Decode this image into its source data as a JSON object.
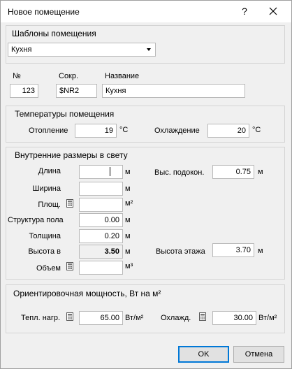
{
  "window": {
    "title": "Новое помещение",
    "help_label": "?"
  },
  "templates": {
    "title": "Шаблоны помещения",
    "selected": "Кухня"
  },
  "ident": {
    "number_label": "№",
    "number_value": "123",
    "short_label": "Сокр.",
    "short_value": "$NR2",
    "name_label": "Название",
    "name_value": "Кухня"
  },
  "temps": {
    "title": "Температуры помещения",
    "heating_label": "Отопление",
    "heating_value": "19",
    "heating_unit": "°C",
    "cooling_label": "Охлаждение",
    "cooling_value": "20",
    "cooling_unit": "°C"
  },
  "dims": {
    "title": "Внутренние размеры в свету",
    "length_label": "Длина",
    "length_value": "",
    "length_unit": "м",
    "width_label": "Ширина",
    "width_value": "",
    "width_unit": "м",
    "area_label": "Площ.",
    "area_value": "",
    "area_unit": "м²",
    "floor_label": "Структура пола",
    "floor_value": "0.00",
    "floor_unit": "м",
    "thickness_label": "Толщина",
    "thickness_value": "0.20",
    "thickness_unit": "м",
    "height_label": "Высота в",
    "height_value": "3.50",
    "height_unit": "м",
    "volume_label": "Объем",
    "volume_value": "",
    "volume_unit": "м³",
    "sill_label": "Выс. подокон.",
    "sill_value": "0.75",
    "sill_unit": "м",
    "floor_height_label": "Высота этажа",
    "floor_height_value": "3.70",
    "floor_height_unit": "м"
  },
  "power": {
    "title": "Ориентировочная мощность, Вт на м²",
    "heat_label": "Тепл. нагр.",
    "heat_value": "65.00",
    "heat_unit": "Вт/м²",
    "cool_label": "Охлажд.",
    "cool_value": "30.00",
    "cool_unit": "Вт/м²"
  },
  "buttons": {
    "ok": "OK",
    "cancel": "Отмена"
  }
}
